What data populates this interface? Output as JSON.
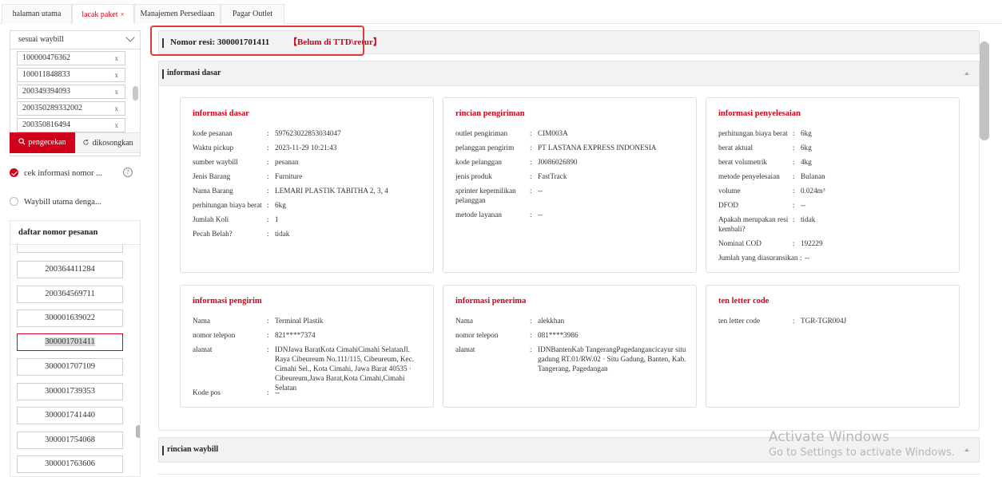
{
  "tabs": [
    {
      "label": "halaman utama",
      "active": false
    },
    {
      "label": "lacak paket",
      "active": true,
      "close": "×"
    },
    {
      "label": "Manajemen Persediaan",
      "active": false
    },
    {
      "label": "Pagar Outlet",
      "active": false
    }
  ],
  "left": {
    "select_value": "sesuai waybill",
    "waybills": [
      "100000476362",
      "100011848833",
      "200349394093",
      "200350289332002",
      "200350816494"
    ],
    "remove_glyph": "x",
    "check_button": "pengecekan",
    "clear_button": "dikosongkan",
    "option_1": "cek informasi nomor ...",
    "option_2": "Waybill utama denga...",
    "help_glyph": "?",
    "order_list_title": "daftar nomor pesanan",
    "orders": [
      "200364411284",
      "200364569711",
      "300001639022",
      "300001701411",
      "300001707109",
      "300001739353",
      "300001741440",
      "300001754068",
      "300001763606"
    ],
    "selected_order": "300001701411"
  },
  "resi": {
    "label": "Nomor resi:  300001701411",
    "status": "【Belum di TTD\\retur】"
  },
  "section_basic": "informasi dasar",
  "section_waybill": "rincian waybill",
  "separator": ":",
  "cards": {
    "dasar": {
      "title": "informasi dasar",
      "rows": [
        {
          "k": "kode pesanan",
          "v": "597623022853034047"
        },
        {
          "k": "Waktu pickup",
          "v": "2023-11-29 10:21:43"
        },
        {
          "k": "sumber waybill",
          "v": "pesanan"
        },
        {
          "k": "Jenis Barang",
          "v": "Furniture"
        },
        {
          "k": "Nama Barang",
          "v": "LEMARI PLASTIK TABITHA 2, 3, 4"
        },
        {
          "k": "perhitungan biaya berat",
          "v": "6kg"
        },
        {
          "k": "Jumlah Koli",
          "v": "1"
        },
        {
          "k": "Pecah Belah?",
          "v": "tidak"
        }
      ]
    },
    "pengiriman": {
      "title": "rincian pengiriman",
      "rows": [
        {
          "k": "outlet pengiriman",
          "v": "CIM003A"
        },
        {
          "k": "pelanggan pengirim",
          "v": "PT LASTANA EXPRESS INDONESIA"
        },
        {
          "k": "kode pelanggan",
          "v": "J0086026890"
        },
        {
          "k": "jenis produk",
          "v": "FastTrack"
        },
        {
          "k": "sprinter kepemilikan pelanggan",
          "v": "--"
        },
        {
          "k": "metode layanan",
          "v": "--"
        }
      ]
    },
    "penyelesaian": {
      "title": "informasi penyelesaian",
      "rows": [
        {
          "k": "perhitungan biaya berat",
          "v": "6kg"
        },
        {
          "k": "berat aktual",
          "v": "6kg"
        },
        {
          "k": "berat volumetrik",
          "v": "4kg"
        },
        {
          "k": "metode penyelesaian",
          "v": "Bulanan"
        },
        {
          "k": "volume",
          "v": "0.024m³"
        },
        {
          "k": "DFOD",
          "v": "--"
        },
        {
          "k": "Apakah merupakan resi kembali?",
          "v": "tidak"
        },
        {
          "k": "Nominal COD",
          "v": "192229"
        },
        {
          "k": "Jumlah yang diasuransikan",
          "v": "--"
        }
      ]
    },
    "pengirim": {
      "title": "informasi pengirim",
      "rows": [
        {
          "k": "Nama",
          "v": "Terminal Plastik"
        },
        {
          "k": "nomor telepon",
          "v": "821****7374"
        },
        {
          "k": "alamat",
          "v": "IDNJawa BaratKota CimahiCimahi SelatanJl. Raya Cibeureum No.111/115, Cibeureum, Kec. Cimahi Sel., Kota Cimahi, Jawa Barat 40535 · Cibeureum,Jawa Barat,Kota Cimahi,Cimahi Selatan"
        },
        {
          "k": "Kode pos",
          "v": "--"
        }
      ]
    },
    "penerima": {
      "title": "informasi penerima",
      "rows": [
        {
          "k": "Nama",
          "v": "alekkhan"
        },
        {
          "k": "nomor telepon",
          "v": "081****3986"
        },
        {
          "k": "alamat",
          "v": "IDNBantenKab TangerangPagedangancicayur situ gadung RT.01/RW.02 · Situ Gadung, Banten, Kab. Tangerang, Pagedangan"
        }
      ]
    },
    "tenletter": {
      "title": "ten letter code",
      "rows": [
        {
          "k": "ten letter code",
          "v": "TGR-TGR004J"
        }
      ]
    }
  },
  "watermark": {
    "line1": "Activate Windows",
    "line2": "Go to Settings to activate Windows."
  }
}
